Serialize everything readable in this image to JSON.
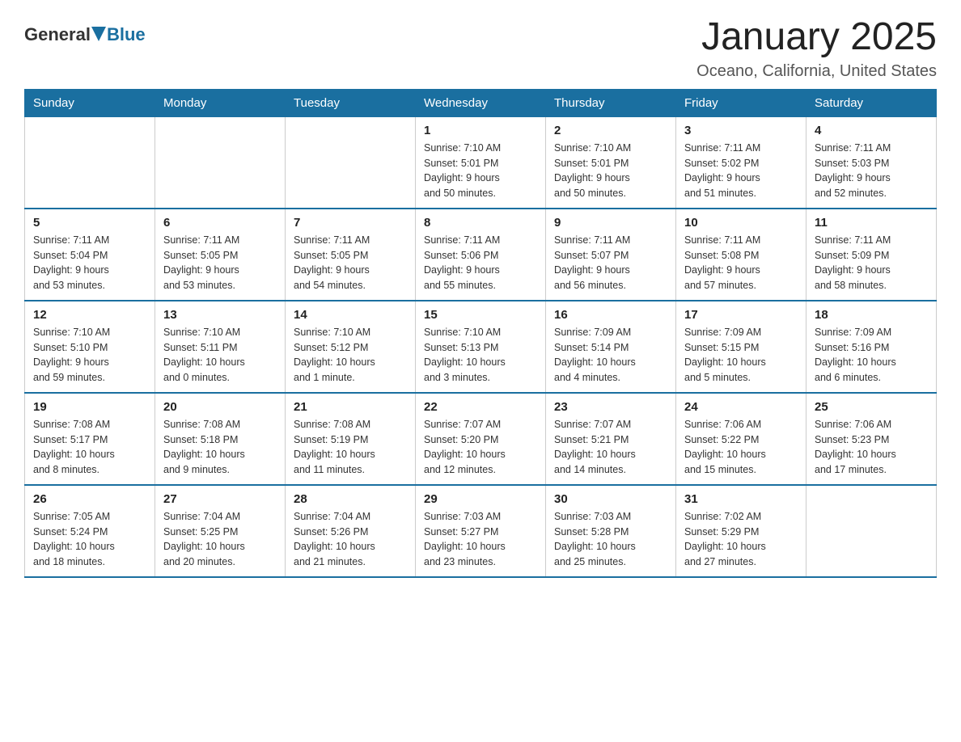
{
  "logo": {
    "general": "General",
    "blue": "Blue"
  },
  "title": "January 2025",
  "subtitle": "Oceano, California, United States",
  "days_of_week": [
    "Sunday",
    "Monday",
    "Tuesday",
    "Wednesday",
    "Thursday",
    "Friday",
    "Saturday"
  ],
  "weeks": [
    [
      {
        "day": "",
        "info": ""
      },
      {
        "day": "",
        "info": ""
      },
      {
        "day": "",
        "info": ""
      },
      {
        "day": "1",
        "info": "Sunrise: 7:10 AM\nSunset: 5:01 PM\nDaylight: 9 hours\nand 50 minutes."
      },
      {
        "day": "2",
        "info": "Sunrise: 7:10 AM\nSunset: 5:01 PM\nDaylight: 9 hours\nand 50 minutes."
      },
      {
        "day": "3",
        "info": "Sunrise: 7:11 AM\nSunset: 5:02 PM\nDaylight: 9 hours\nand 51 minutes."
      },
      {
        "day": "4",
        "info": "Sunrise: 7:11 AM\nSunset: 5:03 PM\nDaylight: 9 hours\nand 52 minutes."
      }
    ],
    [
      {
        "day": "5",
        "info": "Sunrise: 7:11 AM\nSunset: 5:04 PM\nDaylight: 9 hours\nand 53 minutes."
      },
      {
        "day": "6",
        "info": "Sunrise: 7:11 AM\nSunset: 5:05 PM\nDaylight: 9 hours\nand 53 minutes."
      },
      {
        "day": "7",
        "info": "Sunrise: 7:11 AM\nSunset: 5:05 PM\nDaylight: 9 hours\nand 54 minutes."
      },
      {
        "day": "8",
        "info": "Sunrise: 7:11 AM\nSunset: 5:06 PM\nDaylight: 9 hours\nand 55 minutes."
      },
      {
        "day": "9",
        "info": "Sunrise: 7:11 AM\nSunset: 5:07 PM\nDaylight: 9 hours\nand 56 minutes."
      },
      {
        "day": "10",
        "info": "Sunrise: 7:11 AM\nSunset: 5:08 PM\nDaylight: 9 hours\nand 57 minutes."
      },
      {
        "day": "11",
        "info": "Sunrise: 7:11 AM\nSunset: 5:09 PM\nDaylight: 9 hours\nand 58 minutes."
      }
    ],
    [
      {
        "day": "12",
        "info": "Sunrise: 7:10 AM\nSunset: 5:10 PM\nDaylight: 9 hours\nand 59 minutes."
      },
      {
        "day": "13",
        "info": "Sunrise: 7:10 AM\nSunset: 5:11 PM\nDaylight: 10 hours\nand 0 minutes."
      },
      {
        "day": "14",
        "info": "Sunrise: 7:10 AM\nSunset: 5:12 PM\nDaylight: 10 hours\nand 1 minute."
      },
      {
        "day": "15",
        "info": "Sunrise: 7:10 AM\nSunset: 5:13 PM\nDaylight: 10 hours\nand 3 minutes."
      },
      {
        "day": "16",
        "info": "Sunrise: 7:09 AM\nSunset: 5:14 PM\nDaylight: 10 hours\nand 4 minutes."
      },
      {
        "day": "17",
        "info": "Sunrise: 7:09 AM\nSunset: 5:15 PM\nDaylight: 10 hours\nand 5 minutes."
      },
      {
        "day": "18",
        "info": "Sunrise: 7:09 AM\nSunset: 5:16 PM\nDaylight: 10 hours\nand 6 minutes."
      }
    ],
    [
      {
        "day": "19",
        "info": "Sunrise: 7:08 AM\nSunset: 5:17 PM\nDaylight: 10 hours\nand 8 minutes."
      },
      {
        "day": "20",
        "info": "Sunrise: 7:08 AM\nSunset: 5:18 PM\nDaylight: 10 hours\nand 9 minutes."
      },
      {
        "day": "21",
        "info": "Sunrise: 7:08 AM\nSunset: 5:19 PM\nDaylight: 10 hours\nand 11 minutes."
      },
      {
        "day": "22",
        "info": "Sunrise: 7:07 AM\nSunset: 5:20 PM\nDaylight: 10 hours\nand 12 minutes."
      },
      {
        "day": "23",
        "info": "Sunrise: 7:07 AM\nSunset: 5:21 PM\nDaylight: 10 hours\nand 14 minutes."
      },
      {
        "day": "24",
        "info": "Sunrise: 7:06 AM\nSunset: 5:22 PM\nDaylight: 10 hours\nand 15 minutes."
      },
      {
        "day": "25",
        "info": "Sunrise: 7:06 AM\nSunset: 5:23 PM\nDaylight: 10 hours\nand 17 minutes."
      }
    ],
    [
      {
        "day": "26",
        "info": "Sunrise: 7:05 AM\nSunset: 5:24 PM\nDaylight: 10 hours\nand 18 minutes."
      },
      {
        "day": "27",
        "info": "Sunrise: 7:04 AM\nSunset: 5:25 PM\nDaylight: 10 hours\nand 20 minutes."
      },
      {
        "day": "28",
        "info": "Sunrise: 7:04 AM\nSunset: 5:26 PM\nDaylight: 10 hours\nand 21 minutes."
      },
      {
        "day": "29",
        "info": "Sunrise: 7:03 AM\nSunset: 5:27 PM\nDaylight: 10 hours\nand 23 minutes."
      },
      {
        "day": "30",
        "info": "Sunrise: 7:03 AM\nSunset: 5:28 PM\nDaylight: 10 hours\nand 25 minutes."
      },
      {
        "day": "31",
        "info": "Sunrise: 7:02 AM\nSunset: 5:29 PM\nDaylight: 10 hours\nand 27 minutes."
      },
      {
        "day": "",
        "info": ""
      }
    ]
  ]
}
